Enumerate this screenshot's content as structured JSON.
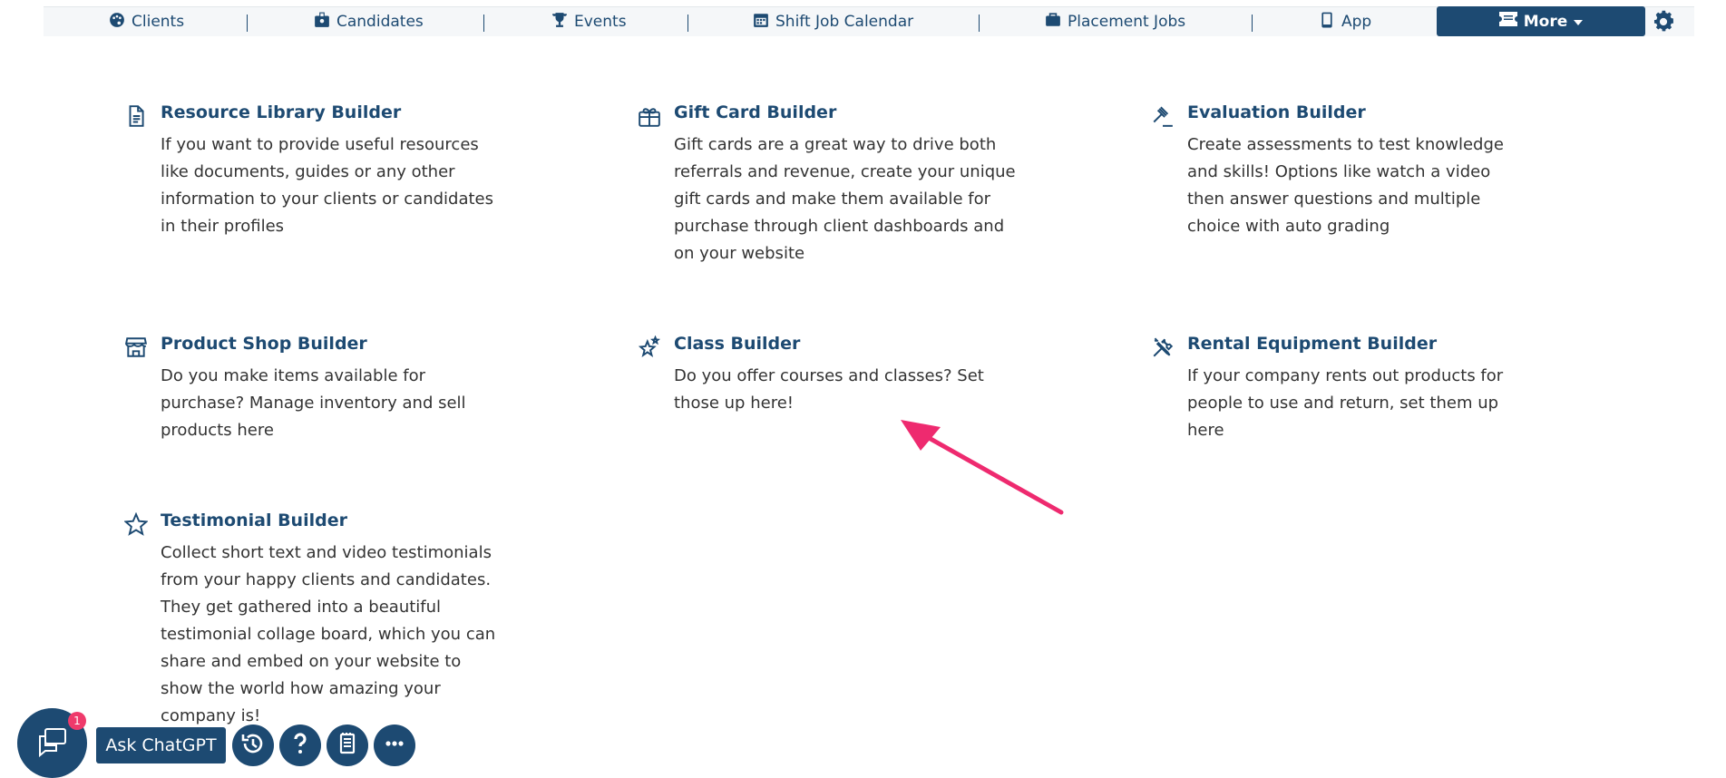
{
  "nav": {
    "items": [
      {
        "label": "Clients",
        "icon": "palette-icon"
      },
      {
        "label": "Candidates",
        "icon": "id-badge-icon"
      },
      {
        "label": "Events",
        "icon": "trophy-icon"
      },
      {
        "label": "Shift Job Calendar",
        "icon": "calendar-icon"
      },
      {
        "label": "Placement Jobs",
        "icon": "briefcase-icon"
      },
      {
        "label": "App",
        "icon": "mobile-icon"
      }
    ],
    "more_label": "More",
    "accent_color": "#1d4a72"
  },
  "builders": [
    {
      "title": "Resource Library Builder",
      "desc": "If you want to provide useful resources like documents, guides or any other information to your clients or candidates in their profiles",
      "icon": "document-icon"
    },
    {
      "title": "Gift Card Builder",
      "desc": "Gift cards are a great way to drive both referrals and revenue, create your unique gift cards and make them available for purchase through client dashboards and on your website",
      "icon": "gift-card-icon"
    },
    {
      "title": "Evaluation Builder",
      "desc": "Create assessments to test knowledge and skills! Options like watch a video then answer questions and multiple choice with auto grading",
      "icon": "gavel-icon"
    },
    {
      "title": "Product Shop Builder",
      "desc": "Do you make items available for purchase? Manage inventory and sell products here",
      "icon": "shop-icon"
    },
    {
      "title": "Class Builder",
      "desc": "Do you offer courses and classes? Set those up here!",
      "icon": "stars-icon"
    },
    {
      "title": "Rental Equipment Builder",
      "desc": "If your company rents out products for people to use and return, set them up here",
      "icon": "tools-icon"
    },
    {
      "title": "Testimonial Builder",
      "desc": "Collect short text and video testimonials from your happy clients and candidates. They get gathered into a beautiful testimonial collage board, which you can share and embed on your website to show the world how amazing your company is!",
      "icon": "star-icon"
    }
  ],
  "footer": {
    "chat_badge": "1",
    "ask_label": "Ask ChatGPT",
    "annotation_color": "#ee2a6f"
  }
}
